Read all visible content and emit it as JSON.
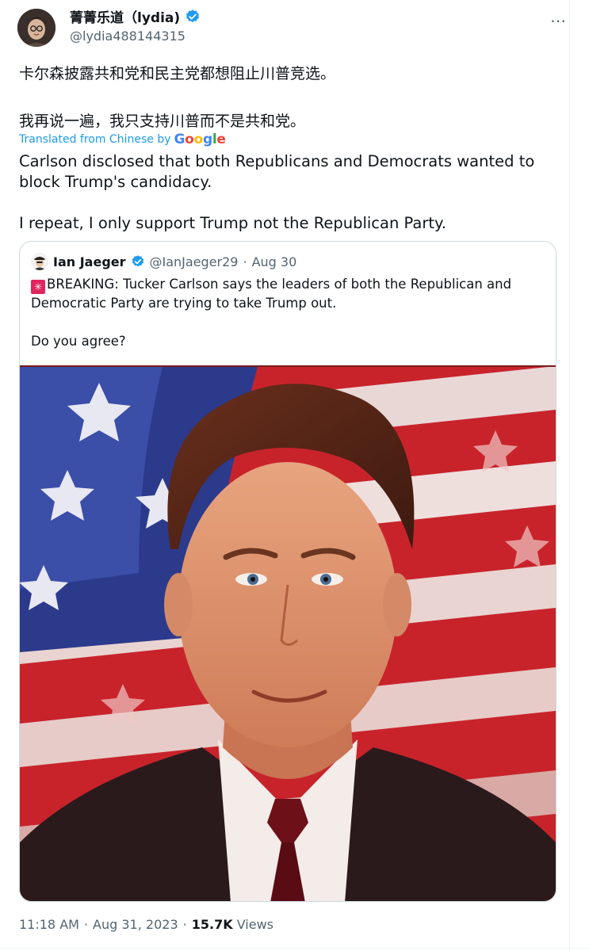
{
  "author": {
    "display_name": "菁菁乐道（lydia)",
    "handle": "@lydia488144315",
    "verified": true,
    "avatar_icon": "user-avatar-icon"
  },
  "more_icon": "⋯",
  "tweet": {
    "original_text": "卡尔森披露共和党和民主党都想阻止川普竞选。\n\n我再说一遍，我只支持川普而不是共和党。",
    "translated_label": "Translated from Chinese by",
    "translation_provider": "Google",
    "translated_text": "Carlson disclosed that both Republicans and Democrats wanted to block Trump's candidacy.\n\nI repeat, I only support Trump not the Republican Party."
  },
  "quoted_tweet": {
    "display_name": "Ian Jaeger",
    "handle": "@IanJaeger29",
    "separator": "·",
    "date": "Aug 30",
    "text_prefix_icon": "siren-icon",
    "text": "BREAKING: Tucker Carlson says the leaders of both the Republican and Democratic Party are trying to take Trump out.\n\nDo you agree?"
  },
  "meta": {
    "time": "11:18 AM",
    "separator": "·",
    "date": "Aug 31, 2023",
    "views_count": "15.7K",
    "views_label": "Views"
  },
  "colors": {
    "link": "#1d9bf0",
    "secondary_text": "#536471",
    "border": "#cfd9de",
    "verified": "#1d9bf0"
  }
}
